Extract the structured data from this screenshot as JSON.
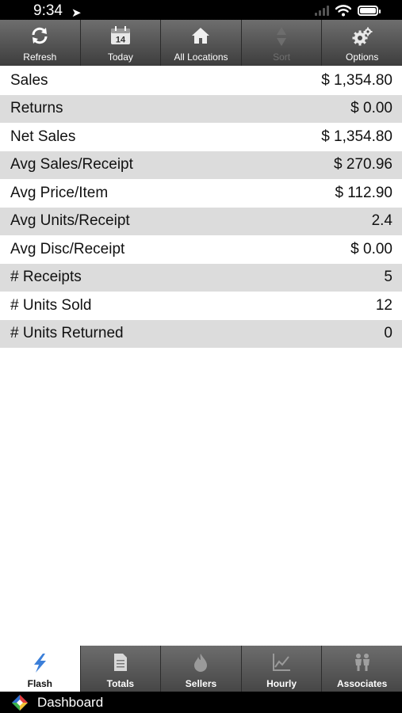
{
  "status": {
    "time": "9:34",
    "location_glyph": "➤"
  },
  "toolbar": [
    {
      "label": "Refresh",
      "icon": "refresh-icon",
      "enabled": true
    },
    {
      "label": "Today",
      "icon": "calendar-icon",
      "calendar_day": "14",
      "enabled": true
    },
    {
      "label": "All Locations",
      "icon": "home-icon",
      "enabled": true
    },
    {
      "label": "Sort",
      "icon": "sort-icon",
      "enabled": false
    },
    {
      "label": "Options",
      "icon": "gear-icon",
      "enabled": true
    }
  ],
  "metrics": [
    {
      "label": "Sales",
      "value": "$ 1,354.80"
    },
    {
      "label": "Returns",
      "value": "$ 0.00"
    },
    {
      "label": "Net Sales",
      "value": "$ 1,354.80"
    },
    {
      "label": "Avg Sales/Receipt",
      "value": "$ 270.96"
    },
    {
      "label": "Avg Price/Item",
      "value": "$ 112.90"
    },
    {
      "label": "Avg Units/Receipt",
      "value": "2.4"
    },
    {
      "label": "Avg Disc/Receipt",
      "value": "$ 0.00"
    },
    {
      "label": "# Receipts",
      "value": "5"
    },
    {
      "label": "# Units Sold",
      "value": "12"
    },
    {
      "label": "# Units Returned",
      "value": "0"
    }
  ],
  "tabs": [
    {
      "label": "Flash",
      "icon": "flash-icon",
      "active": true
    },
    {
      "label": "Totals",
      "icon": "document-icon",
      "active": false
    },
    {
      "label": "Sellers",
      "icon": "flame-icon",
      "active": false
    },
    {
      "label": "Hourly",
      "icon": "line-chart-icon",
      "active": false
    },
    {
      "label": "Associates",
      "icon": "people-icon",
      "active": false
    }
  ],
  "footer": {
    "label": "Dashboard"
  },
  "colors": {
    "toolbar": "#5a5a5a",
    "row_alt": "#dcdcdc",
    "active_tab": "#ffffff",
    "flash_icon": "#3b7fd9"
  }
}
